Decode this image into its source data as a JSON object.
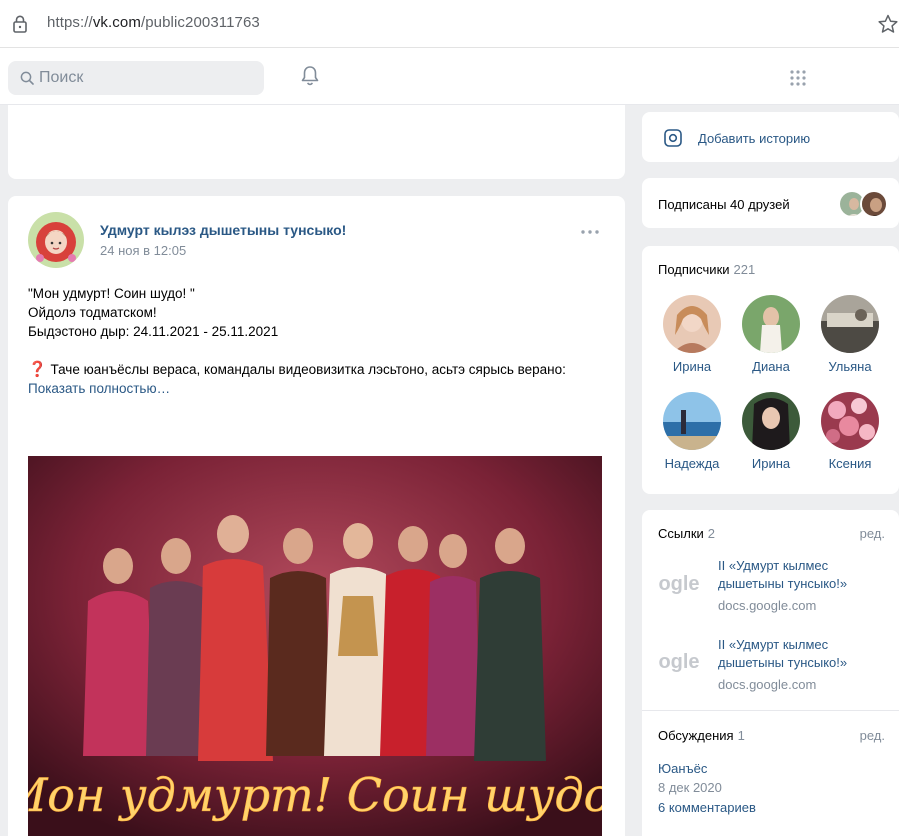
{
  "browser": {
    "url_prefix": "https://",
    "url_host": "vk.com",
    "url_path": "/public200311763"
  },
  "header": {
    "search_placeholder": "Поиск"
  },
  "post": {
    "author": "Удмурт кылэз дышетыны тунсыко!",
    "date": "24 ноя в 12:05",
    "lines": [
      "\"Мон удмурт! Соин шудо! \"",
      "Ойдолэ тодматском!",
      "Быдэстоно дыр: 24.11.2021 - 25.11.2021"
    ],
    "question_mark": "❓",
    "question_text": "Таче юанъёслы вераса, командалы видеовизитка лэсьтоно, асьтэ сярысь верано:",
    "show_more": "Показать полностью…",
    "photo_caption": "Мон удмурт! Соин шудо!"
  },
  "sidebar": {
    "add_story": "Добавить историю",
    "friends_label": "Подписаны 40 друзей",
    "subscribers": {
      "title": "Подписчики",
      "count": "221",
      "people": [
        {
          "name": "Ирина"
        },
        {
          "name": "Диана"
        },
        {
          "name": "Ульяна"
        },
        {
          "name": "Надежда"
        },
        {
          "name": "Ирина"
        },
        {
          "name": "Ксения"
        }
      ]
    },
    "links": {
      "title": "Ссылки",
      "count": "2",
      "edit": "ред.",
      "items": [
        {
          "title": "II «Удмурт кылмес дышетыны тунсыко!»",
          "host": "docs.google.com"
        },
        {
          "title": "II «Удмурт кылмес дышетыны тунсыко!»",
          "host": "docs.google.com"
        }
      ]
    },
    "discussions": {
      "title": "Обсуждения",
      "count": "1",
      "edit": "ред.",
      "topic": "Юанъёс",
      "date": "8 дек 2020",
      "comments": "6 комментариев"
    }
  }
}
